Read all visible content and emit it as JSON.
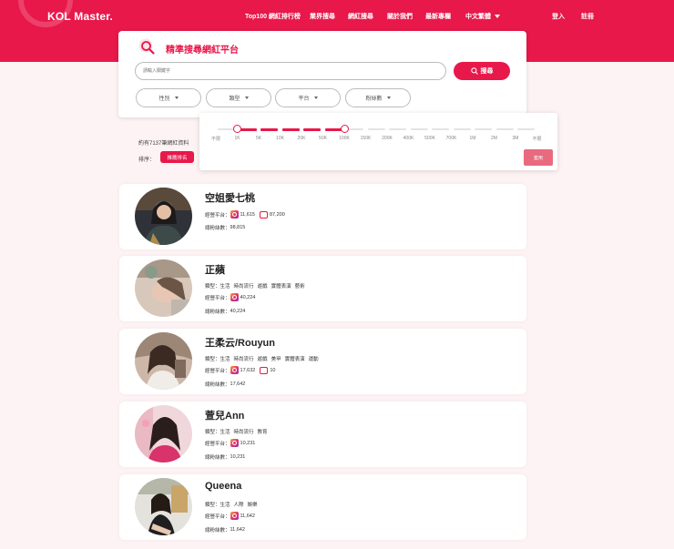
{
  "header": {
    "logo": "KOL Master.",
    "nav": [
      {
        "label": "Top100 網紅排行榜"
      },
      {
        "label": "業界搜尋"
      },
      {
        "label": "網紅搜尋"
      },
      {
        "label": "關於我們"
      },
      {
        "label": "最新專欄"
      },
      {
        "label": "中文繁體"
      }
    ],
    "login": "登入",
    "register": "註冊"
  },
  "search": {
    "title": "精準搜尋網紅平台",
    "placeholder": "請輸入關鍵字",
    "button": "搜尋",
    "filters": [
      {
        "label": "性別"
      },
      {
        "label": "類型"
      },
      {
        "label": "平台"
      },
      {
        "label": "粉絲數"
      }
    ]
  },
  "slider": {
    "ticks": [
      "不限",
      "1K",
      "5K",
      "10K",
      "20K",
      "50K",
      "100K",
      "150K",
      "200K",
      "400K",
      "500K",
      "700K",
      "1M",
      "2M",
      "3M",
      "不限"
    ],
    "range_start_label": "1K",
    "range_end_label": "100K",
    "apply": "套用"
  },
  "results": {
    "count_text": "約有7137筆網紅資料",
    "sort_label": "排序：",
    "sort_button": "推薦排名"
  },
  "labels": {
    "type": "類型：",
    "platform": "經營平台：",
    "followers": "總粉絲數："
  },
  "kols": [
    {
      "name": "空姐愛七桃",
      "tags": [],
      "ig": "11,615",
      "yt": "87,200",
      "total": "98,815"
    },
    {
      "name": "正蘋",
      "tags": [
        "生活",
        "時尚流行",
        "遊戲",
        "實體表演",
        "藝術"
      ],
      "ig": "40,224",
      "yt": null,
      "total": "40,224"
    },
    {
      "name": "王柔云/Rouyun",
      "tags": [
        "生活",
        "時尚流行",
        "遊戲",
        "美甲",
        "實體表演",
        "運動"
      ],
      "ig": "17,632",
      "yt": "10",
      "total": "17,642"
    },
    {
      "name": "萱兒Ann",
      "tags": [
        "生活",
        "時尚流行",
        "教育"
      ],
      "ig": "10,231",
      "yt": null,
      "total": "10,231"
    },
    {
      "name": "Queena",
      "tags": [
        "生活",
        "人際",
        "娛樂"
      ],
      "ig": "11,642",
      "yt": null,
      "total": "11,642"
    }
  ],
  "colors": {
    "brand": "#e8184a",
    "background": "#fdf3f4"
  }
}
